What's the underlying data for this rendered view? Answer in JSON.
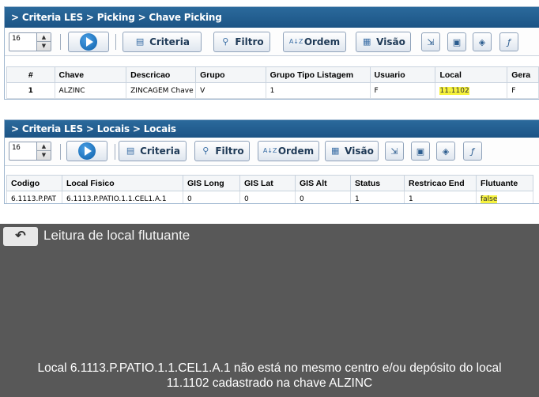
{
  "panel1": {
    "breadcrumb": "> Criteria LES > Picking > Chave Picking",
    "page_size": "16",
    "buttons": {
      "criteria": "Criteria",
      "filtro": "Filtro",
      "ordem": "Ordem",
      "visao": "Visão"
    },
    "columns": [
      "#",
      "Chave",
      "Descricao",
      "Grupo",
      "Grupo Tipo Listagem",
      "Usuario",
      "Local",
      "Gera"
    ],
    "row": [
      "1",
      "ALZINC",
      "ZINCAGEM Chave",
      "V",
      "1",
      "F",
      "11.1102",
      "F"
    ]
  },
  "panel2": {
    "breadcrumb": "> Criteria LES > Locais > Locais",
    "page_size": "16",
    "buttons": {
      "criteria": "Criteria",
      "filtro": "Filtro",
      "ordem": "Ordem",
      "visao": "Visão"
    },
    "columns": [
      "Codigo",
      "Local Fisico",
      "GIS Long",
      "GIS Lat",
      "GIS Alt",
      "Status",
      "Restricao End",
      "Flutuante"
    ],
    "row": [
      "6.1113.P.PAT",
      "6.1113.P.PATIO.1.1.CEL1.A.1",
      "0",
      "0",
      "0",
      "1",
      "1",
      "false"
    ]
  },
  "dialog": {
    "title": "Leitura de local flutuante",
    "message_line1": "Local 6.1113.P.PATIO.1.1.CEL1.A.1 não está no mesmo centro e/ou depósito do local",
    "message_line2": "11.1102 cadastrado na chave ALZINC"
  },
  "icons": {
    "spinner": "spinner-arrows-icon",
    "play": "play-icon",
    "criteria": "criteria-icon",
    "filtro": "funnel-icon",
    "ordem": "sort-az-icon",
    "visao": "view-icon",
    "export": "export-icon",
    "save": "save-icon",
    "code": "code-icon",
    "function": "function-icon",
    "back": "back-arrow-icon"
  },
  "colors": {
    "header_bg": "#1c5485",
    "highlight": "#f6f23d",
    "dialog_bg": "#585858"
  }
}
